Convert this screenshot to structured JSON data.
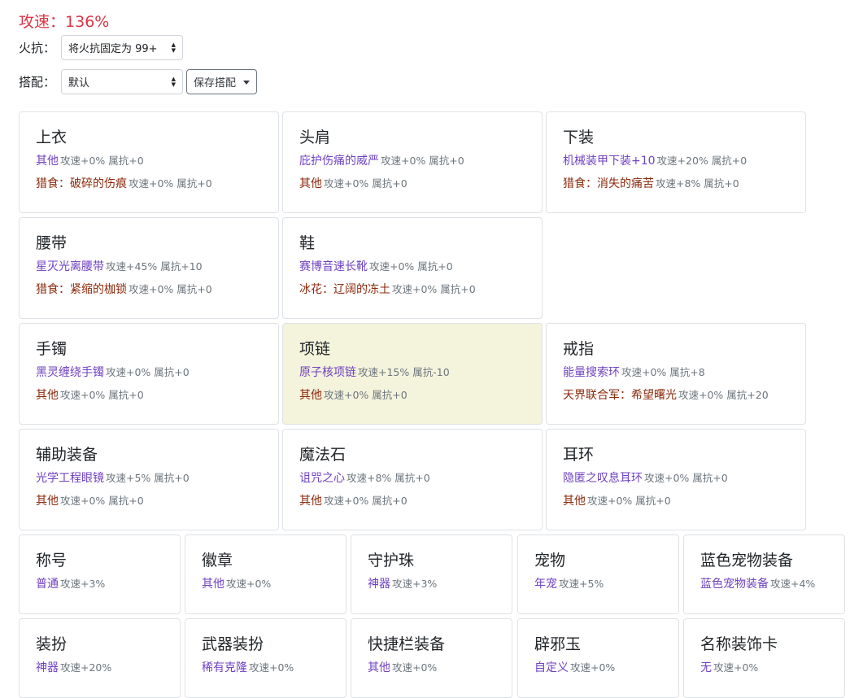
{
  "header": {
    "speed_label": "攻速：",
    "speed_value": "136%"
  },
  "controls": {
    "fire_label": "火抗：",
    "fire_select": "将火抗固定为 99+",
    "outfit_label": "搭配：",
    "outfit_select": "默认",
    "save_button": "保存搭配"
  },
  "slots": [
    {
      "name": "上衣",
      "items": [
        {
          "name": "其他",
          "stats": "攻速+0% 属抗+0",
          "color": "purple"
        },
        {
          "name": "猎食：破碎的伤痕",
          "stats": "攻速+0% 属抗+0",
          "color": "brown"
        }
      ]
    },
    {
      "name": "头肩",
      "items": [
        {
          "name": "庇护伤痛的威严",
          "stats": "攻速+0% 属抗+0",
          "color": "purple"
        },
        {
          "name": "其他",
          "stats": "攻速+0% 属抗+0",
          "color": "brown"
        }
      ]
    },
    {
      "name": "下装",
      "items": [
        {
          "name": "机械装甲下装+10",
          "stats": "攻速+20% 属抗+0",
          "color": "purple"
        },
        {
          "name": "猎食：消失的痛苦",
          "stats": "攻速+8% 属抗+0",
          "color": "brown"
        }
      ]
    },
    {
      "name": "腰带",
      "items": [
        {
          "name": "星灭光离腰带",
          "stats": "攻速+45% 属抗+10",
          "color": "purple"
        },
        {
          "name": "猎食：紧缩的枷锁",
          "stats": "攻速+0% 属抗+0",
          "color": "brown"
        }
      ]
    },
    {
      "name": "鞋",
      "items": [
        {
          "name": "赛博音速长靴",
          "stats": "攻速+0% 属抗+0",
          "color": "purple"
        },
        {
          "name": "冰花：辽阔的冻土",
          "stats": "攻速+0% 属抗+0",
          "color": "brown"
        }
      ]
    },
    {
      "name": "手镯",
      "items": [
        {
          "name": "黑灵缠绕手镯",
          "stats": "攻速+0% 属抗+0",
          "color": "purple"
        },
        {
          "name": "其他",
          "stats": "攻速+0% 属抗+0",
          "color": "brown"
        }
      ]
    },
    {
      "name": "项链",
      "highlight": true,
      "items": [
        {
          "name": "原子核项链",
          "stats": "攻速+15% 属抗-10",
          "color": "purple"
        },
        {
          "name": "其他",
          "stats": "攻速+0% 属抗+0",
          "color": "brown"
        }
      ]
    },
    {
      "name": "戒指",
      "items": [
        {
          "name": "能量搜索环",
          "stats": "攻速+0% 属抗+8",
          "color": "purple"
        },
        {
          "name": "天界联合军：希望曙光",
          "stats": "攻速+0% 属抗+20",
          "color": "brown"
        }
      ]
    },
    {
      "name": "辅助装备",
      "items": [
        {
          "name": "光学工程眼镜",
          "stats": "攻速+5% 属抗+0",
          "color": "purple"
        },
        {
          "name": "其他",
          "stats": "攻速+0% 属抗+0",
          "color": "brown"
        }
      ]
    },
    {
      "name": "魔法石",
      "items": [
        {
          "name": "诅咒之心",
          "stats": "攻速+8% 属抗+0",
          "color": "purple"
        },
        {
          "name": "其他",
          "stats": "攻速+0% 属抗+0",
          "color": "brown"
        }
      ]
    },
    {
      "name": "耳环",
      "items": [
        {
          "name": "隐匿之叹息耳环",
          "stats": "攻速+0% 属抗+0",
          "color": "purple"
        },
        {
          "name": "其他",
          "stats": "攻速+0% 属抗+0",
          "color": "brown"
        }
      ]
    },
    {
      "name": "称号",
      "items": [
        {
          "name": "普通",
          "stats": "攻速+3%",
          "color": "purple"
        }
      ]
    },
    {
      "name": "徽章",
      "items": [
        {
          "name": "其他",
          "stats": "攻速+0%",
          "color": "purple"
        }
      ]
    },
    {
      "name": "守护珠",
      "items": [
        {
          "name": "神器",
          "stats": "攻速+3%",
          "color": "purple"
        }
      ]
    },
    {
      "name": "宠物",
      "items": [
        {
          "name": "年宠",
          "stats": "攻速+5%",
          "color": "purple"
        }
      ]
    },
    {
      "name": "蓝色宠物装备",
      "items": [
        {
          "name": "蓝色宠物装备",
          "stats": "攻速+4%",
          "color": "purple"
        }
      ]
    },
    {
      "name": "装扮",
      "items": [
        {
          "name": "神器",
          "stats": "攻速+20%",
          "color": "purple"
        }
      ]
    },
    {
      "name": "武器装扮",
      "items": [
        {
          "name": "稀有克隆",
          "stats": "攻速+0%",
          "color": "purple"
        }
      ]
    },
    {
      "name": "快捷栏装备",
      "items": [
        {
          "name": "其他",
          "stats": "攻速+0%",
          "color": "purple"
        }
      ]
    },
    {
      "name": "辟邪玉",
      "items": [
        {
          "name": "自定义",
          "stats": "攻速+0%",
          "color": "purple"
        }
      ]
    },
    {
      "name": "名称装饰卡",
      "items": [
        {
          "name": "无",
          "stats": "攻速+0%",
          "color": "purple"
        }
      ]
    }
  ]
}
